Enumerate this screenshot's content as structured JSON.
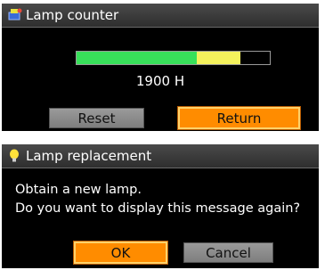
{
  "lamp_counter": {
    "title": "Lamp counter",
    "icon": "lamp-counter-icon",
    "progress": {
      "green_fraction": 0.62,
      "yellow_fraction": 0.23,
      "colors": {
        "green": "#38e05a",
        "yellow": "#f4f25c"
      }
    },
    "hours_text": "1900 H",
    "reset_label": "Reset",
    "return_label": "Return"
  },
  "lamp_replacement": {
    "title": "Lamp replacement",
    "icon": "lightbulb-icon",
    "message_line1": "Obtain a new lamp.",
    "message_line2": "Do you want to display this message again?",
    "ok_label": "OK",
    "cancel_label": "Cancel"
  },
  "colors": {
    "accent_orange": "#ff8c00",
    "button_gray": "#8c8c8c"
  }
}
